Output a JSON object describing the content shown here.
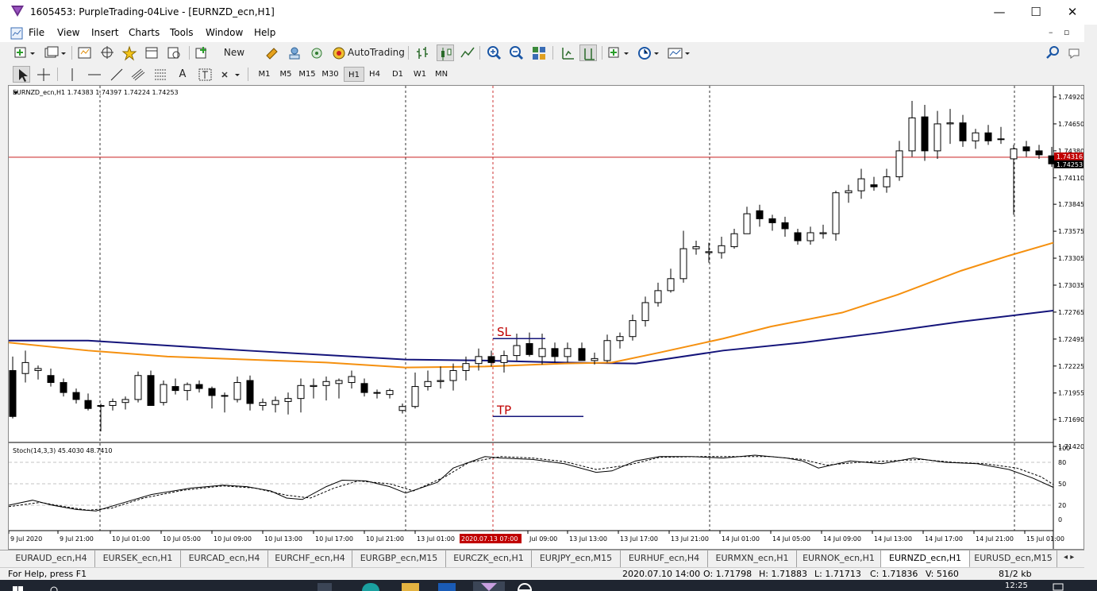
{
  "window": {
    "title": "1605453: PurpleTrading-04Live - [EURNZD_ecn,H1]",
    "minimize": "—",
    "maximize": "☐",
    "close": "✕"
  },
  "menu": [
    "File",
    "View",
    "Insert",
    "Charts",
    "Tools",
    "Window",
    "Help"
  ],
  "toolbar": {
    "new_order": "New Order",
    "autotrading": "AutoTrading",
    "timeframes": [
      "M1",
      "M5",
      "M15",
      "M30",
      "H1",
      "H4",
      "D1",
      "W1",
      "MN"
    ],
    "active_timeframe": "H1"
  },
  "chart": {
    "symbol_info": "EURNZD_ecn,H1  1.74383 1.74397 1.74224 1.74253",
    "price_labels": [
      "1.74920",
      "1.74650",
      "1.74380",
      "1.74110",
      "1.73845",
      "1.73575",
      "1.73305",
      "1.73035",
      "1.72765",
      "1.72495",
      "1.72225",
      "1.71955",
      "1.71690",
      "1.71420"
    ],
    "current_price_red": "1.74316",
    "current_price_black": "1.74253",
    "sl_label": "SL",
    "tp_label": "TP",
    "stoch_info": "Stoch(14,3,3) 45.4030 48.7410",
    "stoch_levels": [
      "100",
      "80",
      "50",
      "20",
      "0"
    ],
    "time_labels": [
      "9 Jul 2020",
      "9 Jul 21:00",
      "10 Jul 01:00",
      "10 Jul 05:00",
      "10 Jul 09:00",
      "10 Jul 13:00",
      "10 Jul 17:00",
      "10 Jul 21:00",
      "13 Jul 01:00",
      "2020.07.13 07:00",
      "Jul 09:00",
      "13 Jul 13:00",
      "13 Jul 17:00",
      "13 Jul 21:00",
      "14 Jul 01:00",
      "14 Jul 05:00",
      "14 Jul 09:00",
      "14 Jul 13:00",
      "14 Jul 17:00",
      "14 Jul 21:00",
      "15 Jul 01:00"
    ],
    "colors": {
      "bull": "#ffffff",
      "bear": "#000000",
      "ma_fast": "#f5900f",
      "ma_slow": "#14147a",
      "sl_tp": "#c00000",
      "line": "#14147a",
      "crosshair": "#c00000",
      "price_line": "#c00000"
    }
  },
  "tabs": [
    "EURAUD_ecn,H4",
    "EURSEK_ecn,H1",
    "EURCAD_ecn,H4",
    "EURCHF_ecn,H4",
    "EURGBP_ecn,M15",
    "EURCZK_ecn,H1",
    "EURJPY_ecn,M15",
    "EURHUF_ecn,H4",
    "EURMXN_ecn,H1",
    "EURNOK_ecn,H1",
    "EURNZD_ecn,H1",
    "EURUSD_ecn,M15"
  ],
  "active_tab": "EURNZD_ecn,H1",
  "status": {
    "help": "For Help, press F1",
    "datetime": "2020.07.10 14:00",
    "open": "O: 1.71798",
    "high": "H: 1.71883",
    "low": "L: 1.71713",
    "close": "C: 1.71836",
    "volume": "V: 5160",
    "traffic": "81/2 kb"
  },
  "taskbar": {
    "time": "12:25"
  }
}
